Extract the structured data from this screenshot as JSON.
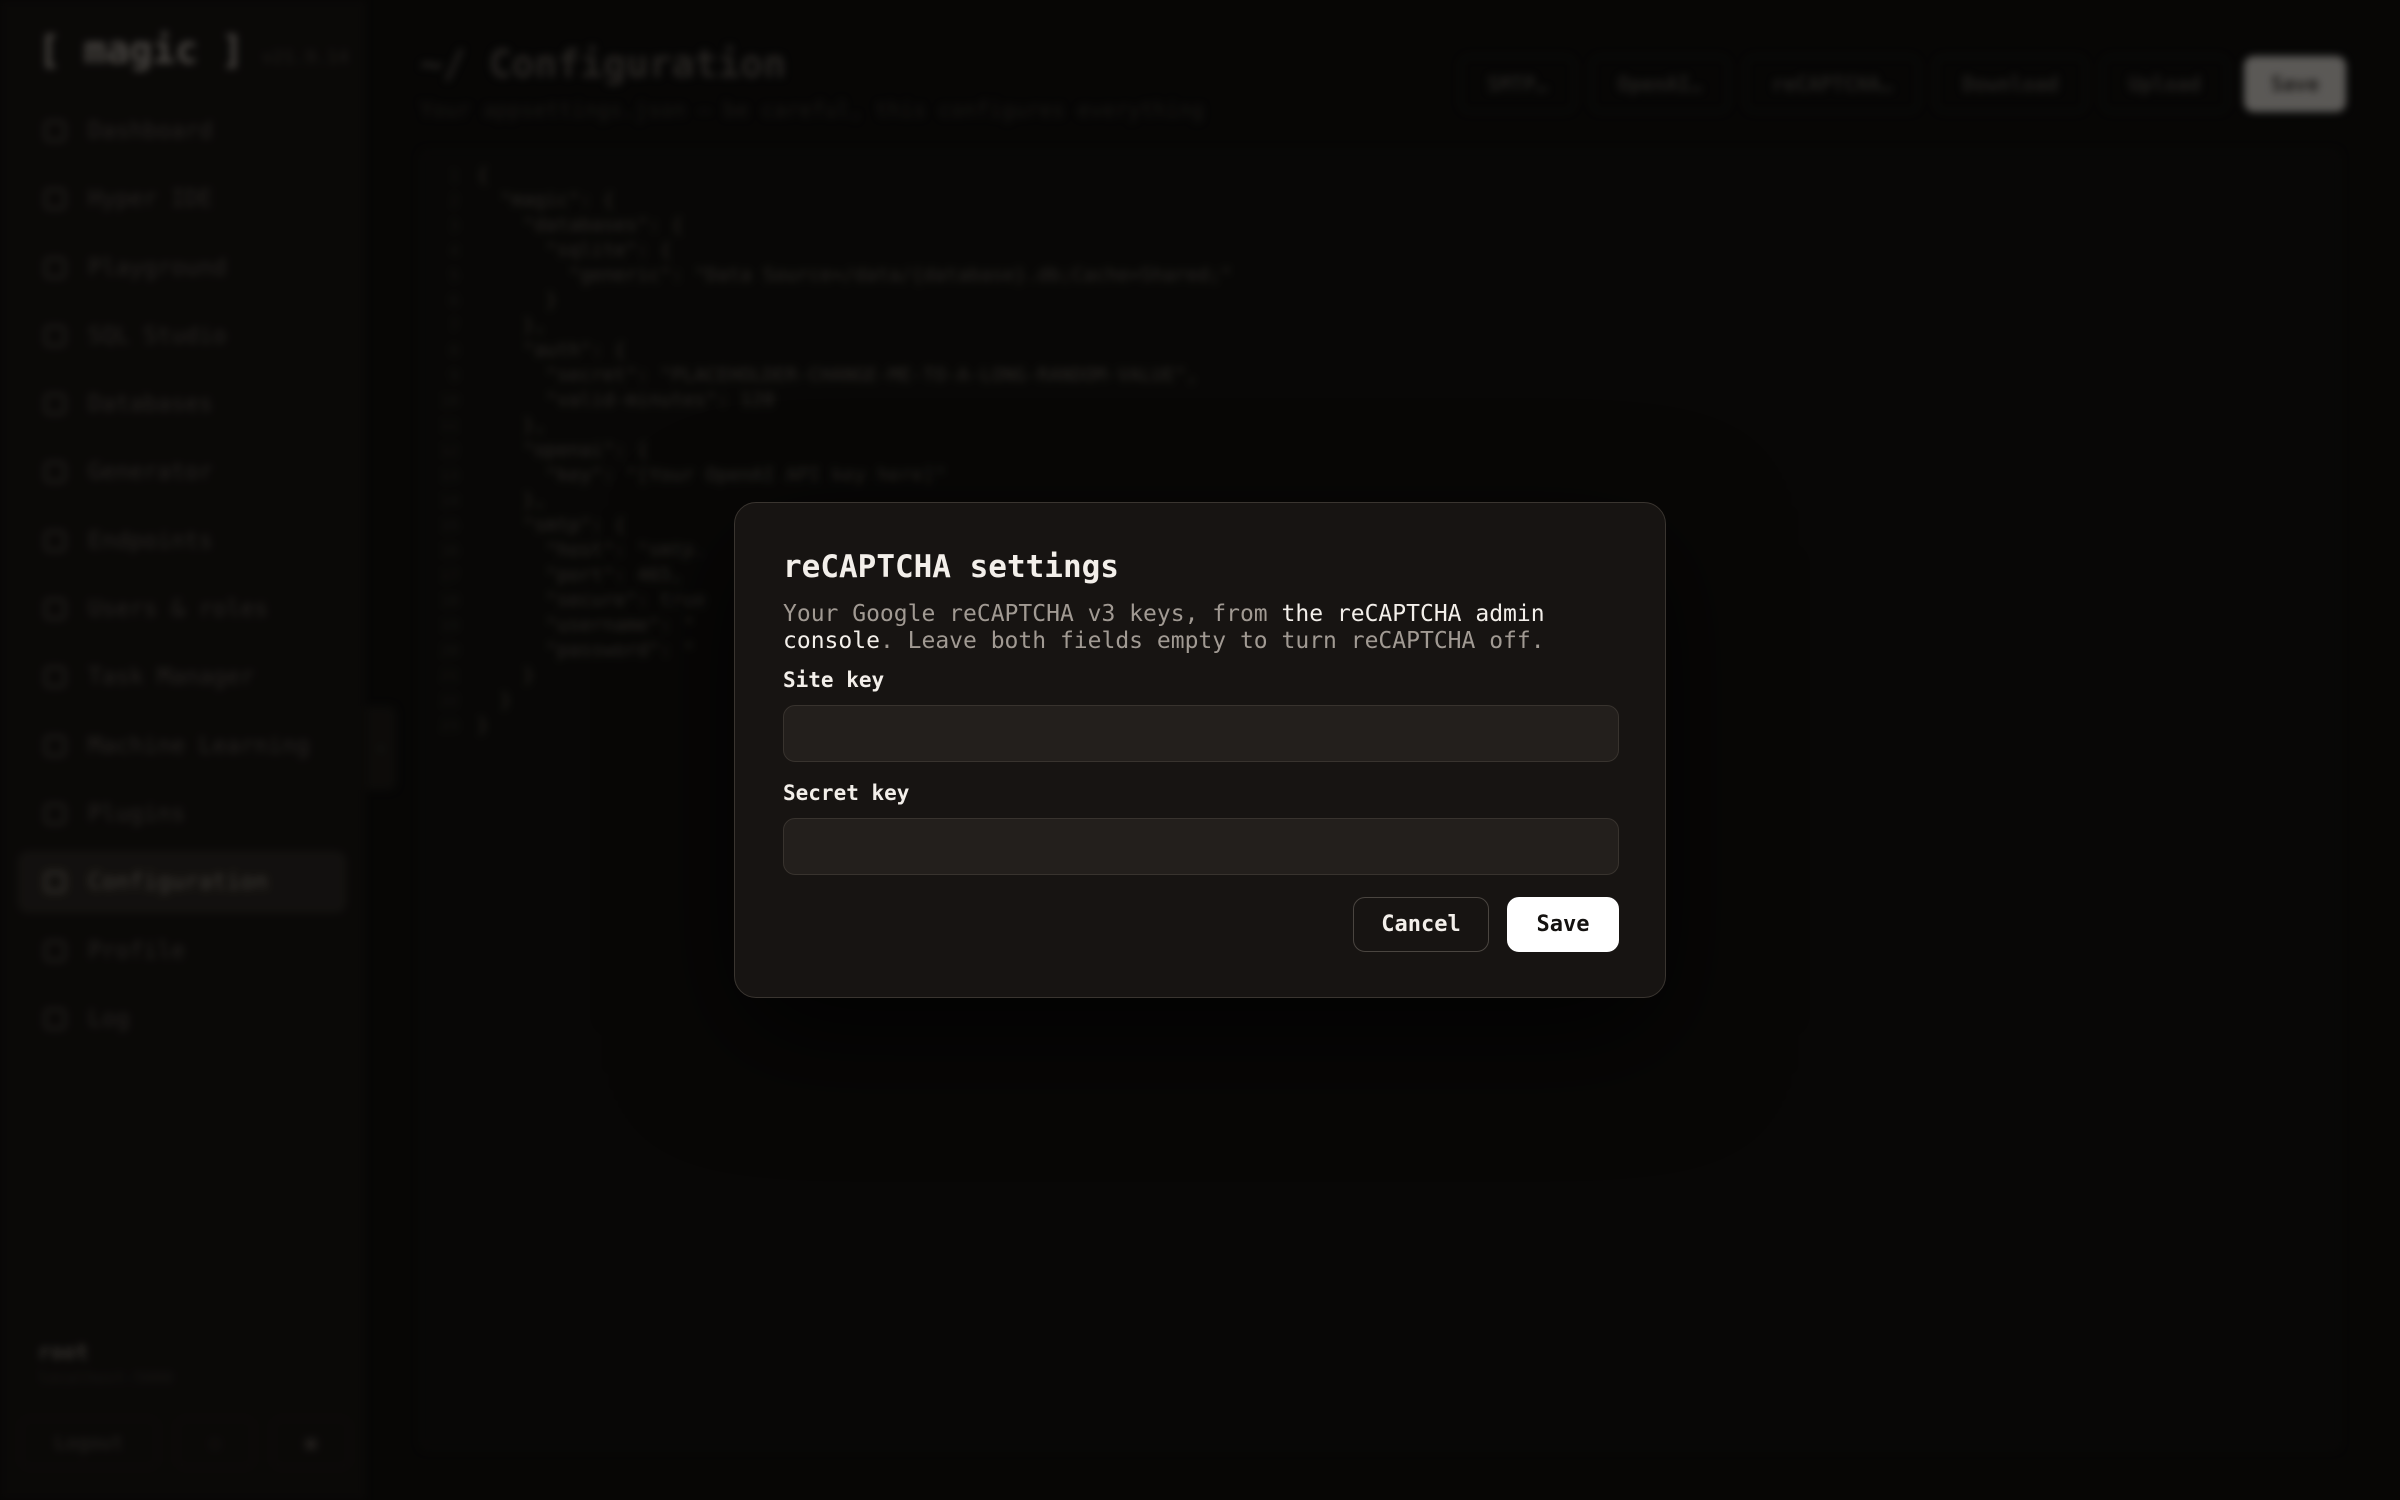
{
  "sidebar": {
    "brand": "[ magic ]",
    "version": "v21.9.14",
    "items": [
      {
        "label": "Dashboard",
        "icon": "home-icon"
      },
      {
        "label": "Hyper IDE",
        "icon": "file-icon"
      },
      {
        "label": "Playground",
        "icon": "play-icon"
      },
      {
        "label": "SQL Studio",
        "icon": "terminal-icon"
      },
      {
        "label": "Databases",
        "icon": "database-icon"
      },
      {
        "label": "Generator",
        "icon": "bolt-icon"
      },
      {
        "label": "Endpoints",
        "icon": "chart-icon"
      },
      {
        "label": "Users & roles",
        "icon": "user-icon"
      },
      {
        "label": "Task Manager",
        "icon": "clock-icon"
      },
      {
        "label": "Machine Learning",
        "icon": "brain-icon"
      },
      {
        "label": "Plugins",
        "icon": "puzzle-icon"
      },
      {
        "label": "Configuration",
        "icon": "sliders-icon",
        "active": true
      },
      {
        "label": "Profile",
        "icon": "globe-icon"
      },
      {
        "label": "Log",
        "icon": "list-icon"
      }
    ],
    "user": {
      "name": "root",
      "host": "localhost:5000"
    },
    "logout_label": "Logout",
    "collapse_glyph": "‹"
  },
  "header": {
    "title": "~/ Configuration",
    "subtitle": "Your appsettings.json — be careful, this configures everything",
    "buttons": [
      "SMTP…",
      "OpenAI…",
      "reCAPTCHA…",
      "Download",
      "Upload"
    ],
    "save_label": "Save"
  },
  "editor": {
    "lines": [
      "{",
      "  \"magic\": {",
      "    \"databases\": {",
      "      \"sqlite\": {",
      "        \"generic\": \"Data Source=/data/{database}.db;Cache=Shared;\"",
      "      }",
      "    },",
      "    \"auth\": {",
      "      \"secret\": \"PLACEHOLDER-CHANGE-ME-TO-A-LONG-RANDOM-VALUE\",",
      "      \"valid-minutes\": 120",
      "    },",
      "    \"openai\": {",
      "      \"key\": \"[Your OpenAI API key here]\"",
      "    },",
      "    \"smtp\": {",
      "      \"host\": \"smtp.",
      "      \"port\": 465,",
      "      \"secure\": true",
      "      \"username\": \"",
      "      \"password\": \"",
      "    }",
      "  }",
      "}"
    ]
  },
  "modal": {
    "title": "reCAPTCHA settings",
    "desc_prefix": "Your Google reCAPTCHA v3 keys, from ",
    "desc_link": "the reCAPTCHA admin console",
    "desc_suffix": ". Leave both fields empty to turn reCAPTCHA off.",
    "site_key_label": "Site key",
    "site_key_value": "",
    "secret_key_label": "Secret key",
    "secret_key_value": "",
    "cancel_label": "Cancel",
    "save_label": "Save"
  }
}
